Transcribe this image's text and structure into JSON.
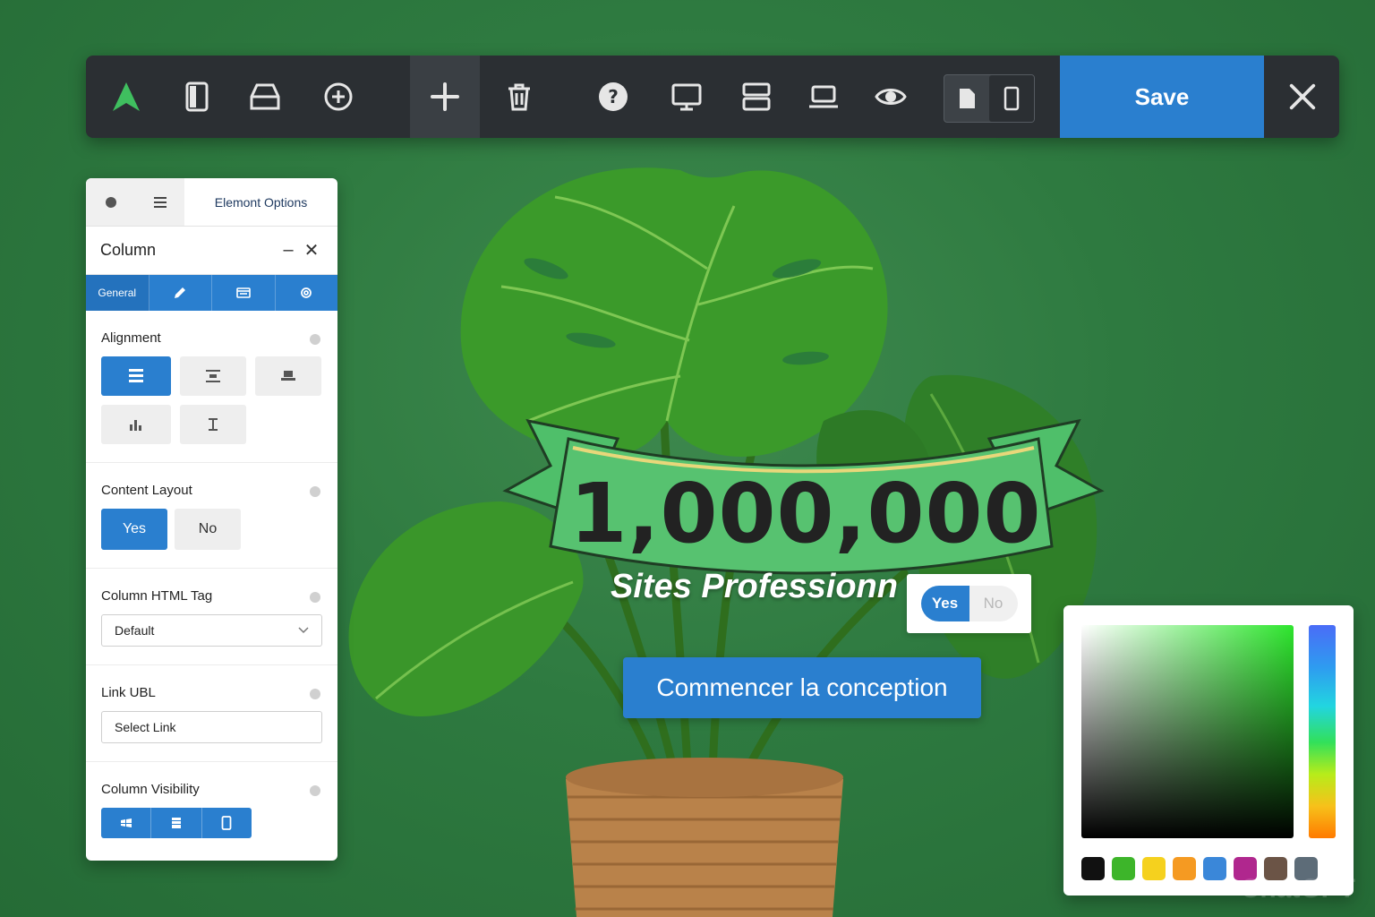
{
  "toolbar": {
    "icons": [
      "logo-icon",
      "sidebar-icon",
      "header-icon",
      "add-circle-icon",
      "plus-icon",
      "trash-icon",
      "help-icon",
      "desktop-icon",
      "rows-icon",
      "laptop-icon",
      "eye-icon",
      "page-icon",
      "mobile-icon",
      "close-icon"
    ],
    "save_label": "Save"
  },
  "panel": {
    "tab_options_label": "Elemont Options",
    "title": "Column",
    "sub_tabs": [
      {
        "label": "General",
        "icon": ""
      },
      {
        "label": "",
        "icon": "pencil-icon"
      },
      {
        "label": "",
        "icon": "card-icon"
      },
      {
        "label": "",
        "icon": "gear-icon"
      }
    ],
    "alignment": {
      "label": "Alignment",
      "selected": 0
    },
    "content_layout": {
      "label": "Content Layout",
      "yes": "Yes",
      "no": "No",
      "selected": "Yes"
    },
    "column_html_tag": {
      "label": "Column HTML Tag",
      "value": "Default"
    },
    "link": {
      "label": "Link UBL",
      "placeholder": "Select Link"
    },
    "visibility": {
      "label": "Column Visibility"
    }
  },
  "hero": {
    "counter": "1,000,000",
    "subtitle": "Sites Professionn",
    "toggle_yes": "Yes",
    "toggle_no": "No",
    "cta": "Commencer la conception"
  },
  "picker": {
    "swatches": [
      "#111111",
      "#3db52a",
      "#f5d11e",
      "#f59a22",
      "#3a87d9",
      "#b0278e",
      "#6b5446",
      "#5d6c78"
    ]
  },
  "watermark": "ChatGPT",
  "colors": {
    "accent": "#2a7fcf",
    "toolbar": "#2b2f33",
    "logo": "#3fbf5f",
    "ribbon": "#4fbf6a"
  }
}
